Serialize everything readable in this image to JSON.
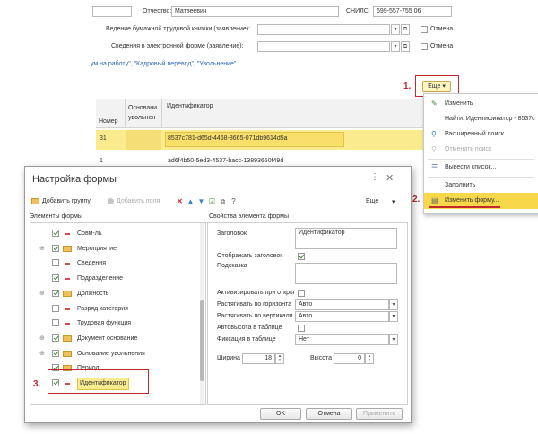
{
  "form_top": {
    "patronymic_label": "Отчество:",
    "patronymic_value": "Матвеевич",
    "snils_label": "СНИЛС:",
    "snils_value": "699-557-755 06",
    "paper_book_label": "Ведение бумажной трудовой книжки (заявление):",
    "electronic_label": "Сведения в электронной форме (заявление):",
    "cancel_label_1": "Отмена",
    "cancel_label_2": "Отмена",
    "links_text": "ум на работу\", \"Кадровый перевод\", \"Увольнение\""
  },
  "toolbar": {
    "more_button": "Еще",
    "more_arrow": "▾",
    "step1": "1."
  },
  "table": {
    "headers": [
      "Номер",
      "Основани\nувольнен",
      "Идентификатор"
    ],
    "rows": [
      {
        "num": "31",
        "id": "8537c781-d65d-4468-8665-071db9614d5a"
      },
      {
        "num": "1",
        "id": "ad6f4b50-5ed3-4537-bacc-13893650f49d"
      }
    ]
  },
  "context_menu": {
    "items": [
      {
        "label": "Изменить",
        "icon": "pencil-icon"
      },
      {
        "label": "Найти: Идентификатор - 8537c",
        "icon": ""
      },
      {
        "label": "Расширенный поиск",
        "icon": "search-icon"
      },
      {
        "label": "Отменить поиск",
        "icon": "cancel-search-icon"
      },
      {
        "label": "Вывести список...",
        "icon": "list-icon"
      },
      {
        "label": "Заполнить",
        "icon": ""
      },
      {
        "label": "Изменить форму...",
        "icon": "form-icon"
      }
    ],
    "step2": "2."
  },
  "dialog": {
    "title": "Настройка формы",
    "add_group": "Добавить группу",
    "add_fields": "Добавить поля",
    "more": "Еще",
    "elements_header": "Элементы формы",
    "properties_header": "Свойства элемента формы",
    "tree": [
      {
        "label": "Совм-ль",
        "type": "field",
        "checked": true,
        "expand": false
      },
      {
        "label": "Мероприятие",
        "type": "folder",
        "checked": true,
        "expand": true
      },
      {
        "label": "Сведения",
        "type": "field",
        "checked": false,
        "expand": false
      },
      {
        "label": "Подразделение",
        "type": "field",
        "checked": true,
        "expand": false
      },
      {
        "label": "Должность",
        "type": "folder",
        "checked": true,
        "expand": true
      },
      {
        "label": "Разряд категория",
        "type": "field",
        "checked": false,
        "expand": false
      },
      {
        "label": "Трудовая функция",
        "type": "field",
        "checked": false,
        "expand": false
      },
      {
        "label": "Документ основание",
        "type": "folder",
        "checked": true,
        "expand": true
      },
      {
        "label": "Основание увольнения",
        "type": "folder",
        "checked": true,
        "expand": true
      },
      {
        "label": "Период",
        "type": "folder",
        "checked": true,
        "expand": false
      },
      {
        "label": "Идентификатор",
        "type": "field",
        "checked": true,
        "expand": false
      }
    ],
    "step3": "3.",
    "props": {
      "title_label": "Заголовок",
      "title_value": "Идентификатор",
      "show_title_label": "Отображать заголовок",
      "show_title_checked": true,
      "hint_label": "Подсказка",
      "activate_label": "Активизировать при откры",
      "stretch_h_label": "Растягивать по горизонта",
      "stretch_h_value": "Авто",
      "stretch_v_label": "Растягивать по вертикали",
      "stretch_v_value": "Авто",
      "autoheight_label": "Автовысота в таблице",
      "fix_label": "Фиксация в таблице",
      "fix_value": "Нет",
      "width_label": "Ширина",
      "width_value": "18",
      "height_label": "Высота",
      "height_value": "0"
    },
    "ok": "OK",
    "cancel": "Отмена",
    "apply": "Применить"
  }
}
